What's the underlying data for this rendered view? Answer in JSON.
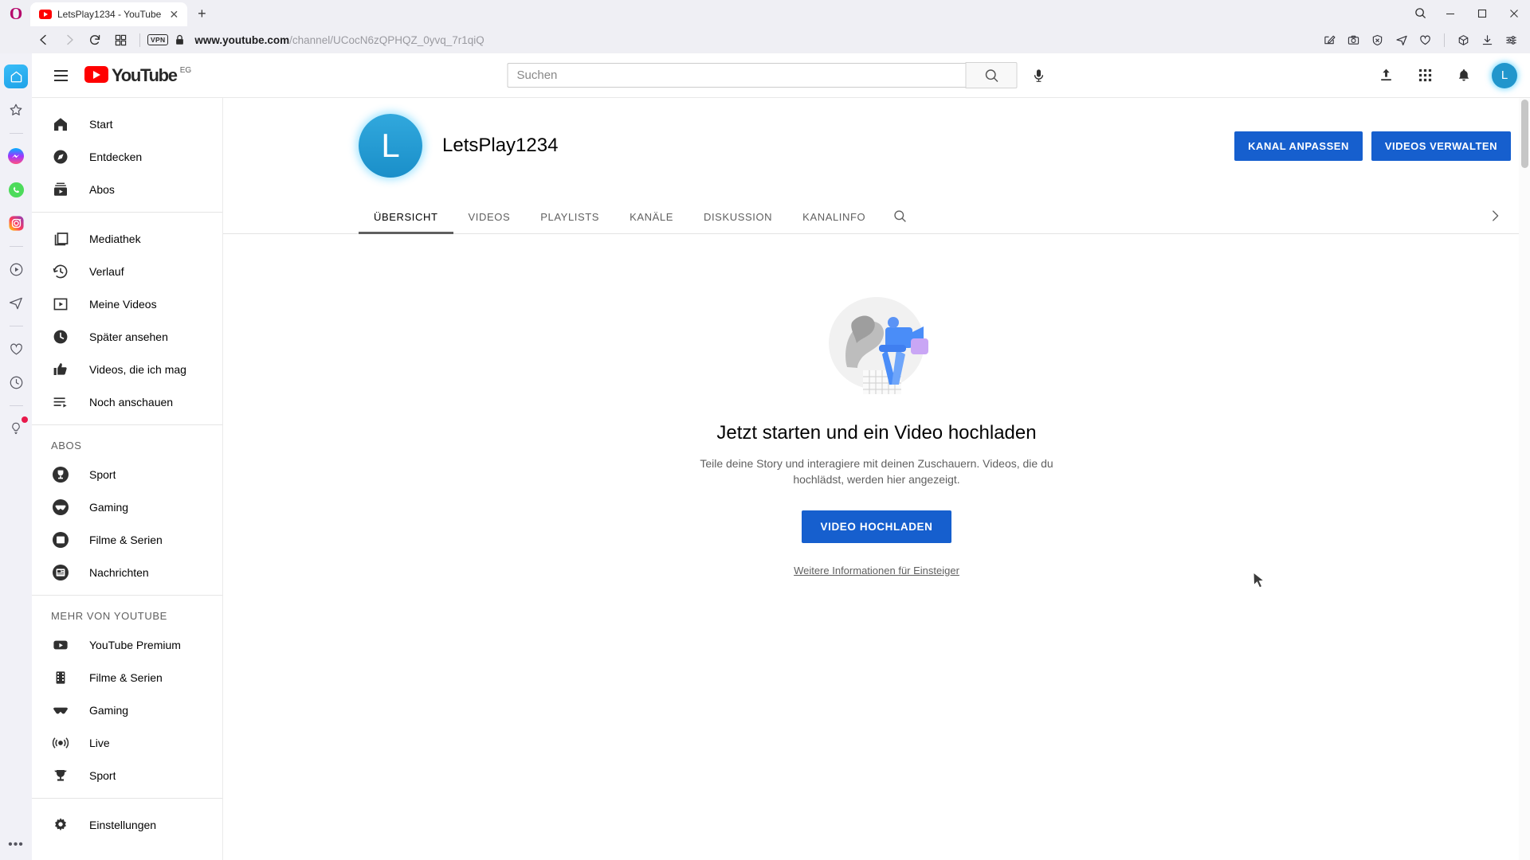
{
  "browser": {
    "opera_logo": "opera-logo",
    "tab": {
      "title": "LetsPlay1234 - YouTube",
      "close": "✕"
    },
    "newtab_label": "+",
    "window_controls": {
      "search": "search-icon",
      "minimize": "—",
      "maximize": "▢",
      "close": "✕"
    },
    "toolbar": {
      "back": "back-arrow-icon",
      "forward": "forward-arrow-icon",
      "reload": "reload-icon",
      "tile": "tile-icon",
      "vpn_badge": "VPN",
      "lock": "lock-icon",
      "url_prefix": "www.youtube.com",
      "url_path": "/channel/UCocN6zQPHQZ_0yvq_7r1qiQ",
      "right_icons": [
        "snapshot-edit-icon",
        "camera-icon",
        "adblock-shield-icon",
        "send-to-messenger-icon",
        "heart-icon",
        "crypto-wallet-icon",
        "downloads-icon",
        "easy-setup-icon"
      ]
    },
    "sidebar": {
      "items": [
        {
          "name": "opera-home-icon",
          "active": true
        },
        {
          "name": "favorites-star-icon",
          "active": false
        },
        {
          "name": "messenger-icon",
          "active": false
        },
        {
          "name": "whatsapp-icon",
          "active": false
        },
        {
          "name": "instagram-icon",
          "active": false
        },
        {
          "name": "player-icon",
          "active": false
        },
        {
          "name": "telegram-icon",
          "active": false
        },
        {
          "name": "heart-pinboard-icon",
          "active": false
        },
        {
          "name": "history-clock-icon",
          "active": false
        },
        {
          "name": "lightbulb-tips-icon",
          "active": false,
          "badge": true
        }
      ],
      "more": "•••"
    }
  },
  "youtube": {
    "header": {
      "menu": "hamburger-menu-icon",
      "logo_text": "YouTube",
      "logo_country": "EG",
      "search_placeholder": "Suchen",
      "search_value": "",
      "search_button": "search-icon",
      "mic": "microphone-icon",
      "upload": "upload-icon",
      "apps": "apps-grid-icon",
      "notifications": "notification-bell-icon",
      "avatar_initial": "L"
    },
    "nav": {
      "groups": [
        {
          "heading": "",
          "items": [
            {
              "label": "Start",
              "icon": "home-icon"
            },
            {
              "label": "Entdecken",
              "icon": "compass-icon"
            },
            {
              "label": "Abos",
              "icon": "subscriptions-icon"
            }
          ]
        },
        {
          "heading": "",
          "items": [
            {
              "label": "Mediathek",
              "icon": "library-icon"
            },
            {
              "label": "Verlauf",
              "icon": "history-icon"
            },
            {
              "label": "Meine Videos",
              "icon": "your-videos-icon"
            },
            {
              "label": "Später ansehen",
              "icon": "watch-later-icon"
            },
            {
              "label": "Videos, die ich mag",
              "icon": "thumbs-up-icon"
            },
            {
              "label": "Noch anschauen",
              "icon": "playlist-icon"
            }
          ]
        },
        {
          "heading": "ABOS",
          "items": [
            {
              "label": "Sport",
              "icon": "trophy-avatar-icon"
            },
            {
              "label": "Gaming",
              "icon": "gaming-avatar-icon"
            },
            {
              "label": "Filme & Serien",
              "icon": "film-avatar-icon"
            },
            {
              "label": "Nachrichten",
              "icon": "news-avatar-icon"
            }
          ]
        },
        {
          "heading": "MEHR VON YOUTUBE",
          "items": [
            {
              "label": "YouTube Premium",
              "icon": "youtube-premium-icon"
            },
            {
              "label": "Filme & Serien",
              "icon": "film-strip-icon"
            },
            {
              "label": "Gaming",
              "icon": "gamepad-icon"
            },
            {
              "label": "Live",
              "icon": "live-broadcast-icon"
            },
            {
              "label": "Sport",
              "icon": "trophy-icon"
            }
          ]
        },
        {
          "heading": "",
          "items": [
            {
              "label": "Einstellungen",
              "icon": "gear-icon"
            }
          ]
        }
      ]
    },
    "channel": {
      "avatar_initial": "L",
      "name": "LetsPlay1234",
      "customize_button": "KANAL ANPASSEN",
      "manage_videos_button": "VIDEOS VERWALTEN",
      "tabs": [
        {
          "label": "ÜBERSICHT",
          "active": true
        },
        {
          "label": "VIDEOS",
          "active": false
        },
        {
          "label": "PLAYLISTS",
          "active": false
        },
        {
          "label": "KANÄLE",
          "active": false
        },
        {
          "label": "DISKUSSION",
          "active": false
        },
        {
          "label": "KANALINFO",
          "active": false
        }
      ],
      "tab_search_icon": "search-icon",
      "tab_next_icon": "chevron-right-icon"
    },
    "empty_state": {
      "illustration": "upload-video-illustration",
      "title": "Jetzt starten und ein Video hochladen",
      "subtitle": "Teile deine Story und interagiere mit deinen Zuschauern. Videos, die du hochlädst, werden hier angezeigt.",
      "upload_button": "VIDEO HOCHLADEN",
      "help_link": "Weitere Informationen für Einsteiger"
    }
  }
}
